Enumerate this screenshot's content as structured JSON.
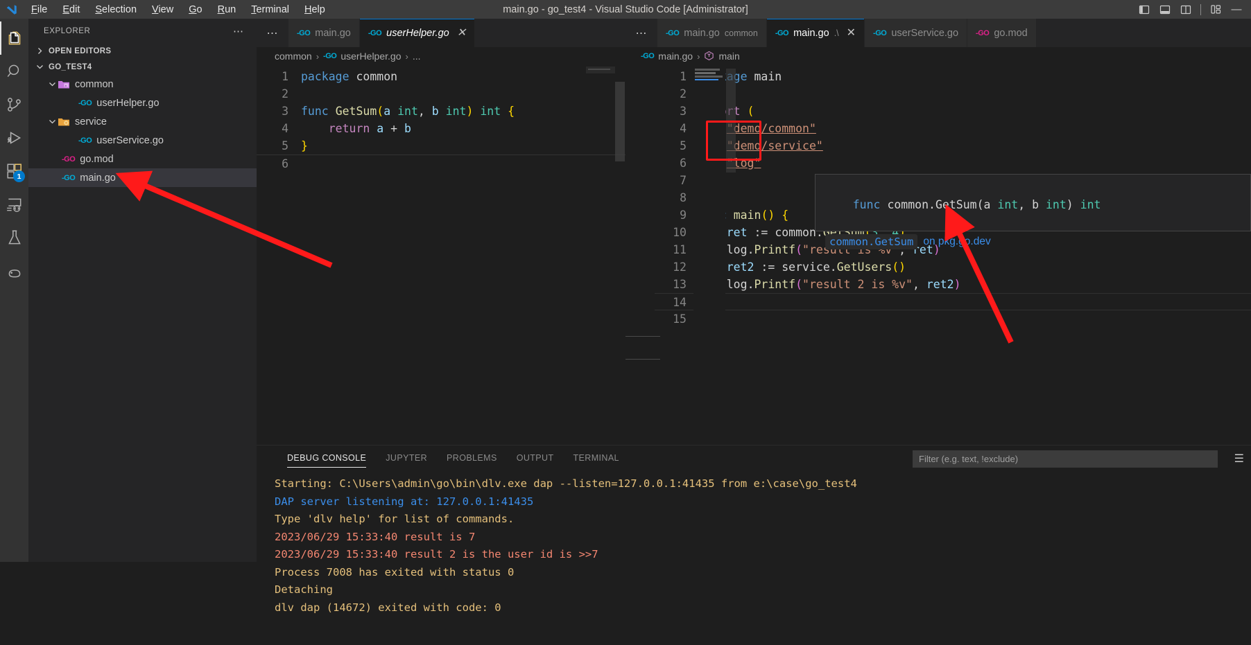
{
  "titlebar": {
    "window_title": "main.go - go_test4 - Visual Studio Code [Administrator]",
    "menus": [
      "File",
      "Edit",
      "Selection",
      "View",
      "Go",
      "Run",
      "Terminal",
      "Help"
    ],
    "layout_buttons": [
      {
        "name": "toggle-primary-sidebar-icon",
        "label": "Toggle Primary Side Bar"
      },
      {
        "name": "toggle-panel-icon",
        "label": "Toggle Panel"
      },
      {
        "name": "toggle-secondary-sidebar-icon",
        "label": "Toggle Secondary Side Bar"
      },
      {
        "name": "customize-layout-icon",
        "label": "Customize Layout"
      }
    ],
    "minimize_label": "—"
  },
  "activitybar": {
    "items": [
      {
        "name": "explorer",
        "icon": "files-icon",
        "active": true,
        "badge": null
      },
      {
        "name": "search",
        "icon": "search-icon",
        "active": false,
        "badge": null
      },
      {
        "name": "source-control",
        "icon": "source-control-icon",
        "active": false,
        "badge": null
      },
      {
        "name": "run-and-debug",
        "icon": "run-debug-icon",
        "active": false,
        "badge": null
      },
      {
        "name": "extensions",
        "icon": "extensions-icon",
        "active": false,
        "badge": "1"
      },
      {
        "name": "remote-explorer",
        "icon": "remote-explorer-icon",
        "active": false,
        "badge": null
      },
      {
        "name": "testing",
        "icon": "beaker-icon",
        "active": false,
        "badge": null
      },
      {
        "name": "python",
        "icon": "python-icon",
        "active": false,
        "badge": null
      }
    ]
  },
  "sidebar": {
    "title": "EXPLORER",
    "more_label": "⋯",
    "open_editors": {
      "label": "OPEN EDITORS",
      "expanded": false
    },
    "workspace": {
      "label": "GO_TEST4",
      "expanded": true
    },
    "tree": [
      {
        "label": "common",
        "type": "folder",
        "depth": 1,
        "expanded": true,
        "selected": false
      },
      {
        "label": "userHelper.go",
        "type": "go",
        "depth": 2,
        "selected": false
      },
      {
        "label": "service",
        "type": "folder",
        "depth": 1,
        "expanded": true,
        "selected": false
      },
      {
        "label": "userService.go",
        "type": "go",
        "depth": 2,
        "selected": false
      },
      {
        "label": "go.mod",
        "type": "gomod",
        "depth": 1,
        "selected": false
      },
      {
        "label": "main.go",
        "type": "go",
        "depth": 1,
        "selected": true
      }
    ]
  },
  "editor_left": {
    "more_label": "⋯",
    "tabs": [
      {
        "label": "main.go",
        "icon": "go-file-icon",
        "active": false,
        "preview": false,
        "closable": false,
        "description": ""
      },
      {
        "label": "userHelper.go",
        "icon": "go-file-icon",
        "active": true,
        "preview": true,
        "closable": true,
        "description": ""
      }
    ],
    "breadcrumb": [
      "common",
      "userHelper.go",
      "..."
    ],
    "lines": [
      {
        "n": "1",
        "tokens": [
          {
            "t": "package",
            "c": "kw"
          },
          {
            "t": " ",
            "c": "pun"
          },
          {
            "t": "common",
            "c": "ident"
          }
        ]
      },
      {
        "n": "2",
        "tokens": []
      },
      {
        "n": "3",
        "tokens": [
          {
            "t": "func",
            "c": "kw"
          },
          {
            "t": " ",
            "c": "pun"
          },
          {
            "t": "GetSum",
            "c": "fn"
          },
          {
            "t": "(",
            "c": "brk1"
          },
          {
            "t": "a ",
            "c": "var"
          },
          {
            "t": "int",
            "c": "typ"
          },
          {
            "t": ", ",
            "c": "pun"
          },
          {
            "t": "b ",
            "c": "var"
          },
          {
            "t": "int",
            "c": "typ"
          },
          {
            "t": ")",
            "c": "brk1"
          },
          {
            "t": " ",
            "c": "pun"
          },
          {
            "t": "int",
            "c": "typ"
          },
          {
            "t": " ",
            "c": "pun"
          },
          {
            "t": "{",
            "c": "brk1"
          }
        ]
      },
      {
        "n": "4",
        "tokens": [
          {
            "t": "    ",
            "c": "pun"
          },
          {
            "t": "return",
            "c": "kw2"
          },
          {
            "t": " a ",
            "c": "var"
          },
          {
            "t": "+",
            "c": "pun"
          },
          {
            "t": " b",
            "c": "var"
          }
        ]
      },
      {
        "n": "5",
        "tokens": [
          {
            "t": "}",
            "c": "brk1"
          }
        ]
      },
      {
        "n": "6",
        "tokens": []
      }
    ]
  },
  "editor_right": {
    "more_label": "⋯",
    "tabs": [
      {
        "label": "main.go",
        "icon": "go-file-icon",
        "active": false,
        "preview": false,
        "closable": false,
        "description": "common"
      },
      {
        "label": "main.go",
        "icon": "go-file-icon",
        "active": true,
        "preview": false,
        "closable": true,
        "description": ".\\"
      },
      {
        "label": "userService.go",
        "icon": "go-file-icon",
        "active": false,
        "preview": false,
        "closable": false,
        "description": ""
      },
      {
        "label": "go.mod",
        "icon": "gomod-file-icon",
        "active": false,
        "preview": false,
        "closable": false,
        "description": ""
      }
    ],
    "breadcrumb": [
      "main.go",
      "main"
    ],
    "lines": [
      {
        "n": "1",
        "tokens": [
          {
            "t": "package",
            "c": "kw"
          },
          {
            "t": " ",
            "c": "pun"
          },
          {
            "t": "main",
            "c": "ident"
          }
        ]
      },
      {
        "n": "2",
        "tokens": []
      },
      {
        "n": "3",
        "tokens": [
          {
            "t": "import",
            "c": "kw2"
          },
          {
            "t": " ",
            "c": "pun"
          },
          {
            "t": "(",
            "c": "brk1"
          }
        ]
      },
      {
        "n": "4",
        "tokens": [
          {
            "t": "    ",
            "c": "pun"
          },
          {
            "t": "\"demo/common\"",
            "c": "str uline"
          }
        ]
      },
      {
        "n": "5",
        "tokens": [
          {
            "t": "    ",
            "c": "pun"
          },
          {
            "t": "\"demo/service\"",
            "c": "str uline"
          }
        ]
      },
      {
        "n": "6",
        "tokens": [
          {
            "t": "    ",
            "c": "pun"
          },
          {
            "t": "\"log\"",
            "c": "str uline"
          }
        ]
      },
      {
        "n": "7",
        "tokens": [
          {
            "t": ")",
            "c": "brk1"
          }
        ]
      },
      {
        "n": "8",
        "tokens": []
      },
      {
        "n": "9",
        "tokens": [
          {
            "t": "func",
            "c": "kw"
          },
          {
            "t": " ",
            "c": "pun"
          },
          {
            "t": "main",
            "c": "fn"
          },
          {
            "t": "()",
            "c": "brk1"
          },
          {
            "t": " ",
            "c": "pun"
          },
          {
            "t": "{",
            "c": "brk1"
          }
        ]
      },
      {
        "n": "10",
        "tokens": [
          {
            "t": "    ",
            "c": "pun"
          },
          {
            "t": "ret",
            "c": "var"
          },
          {
            "t": " := ",
            "c": "pun"
          },
          {
            "t": "common",
            "c": "ident"
          },
          {
            "t": ".",
            "c": "pun"
          },
          {
            "t": "GetSum",
            "c": "fn"
          },
          {
            "t": "(",
            "c": "brk1"
          },
          {
            "t": "3",
            "c": "typ"
          },
          {
            "t": ", ",
            "c": "pun"
          },
          {
            "t": "4",
            "c": "typ"
          },
          {
            "t": ")",
            "c": "brk1"
          }
        ]
      },
      {
        "n": "11",
        "tokens": [
          {
            "t": "    ",
            "c": "pun"
          },
          {
            "t": "log",
            "c": "ident"
          },
          {
            "t": ".",
            "c": "pun"
          },
          {
            "t": "Printf",
            "c": "fn"
          },
          {
            "t": "(",
            "c": "brk2"
          },
          {
            "t": "\"result is %v\"",
            "c": "str"
          },
          {
            "t": ", ",
            "c": "pun"
          },
          {
            "t": "ret",
            "c": "var"
          },
          {
            "t": ")",
            "c": "brk2"
          }
        ]
      },
      {
        "n": "12",
        "tokens": [
          {
            "t": "    ",
            "c": "pun"
          },
          {
            "t": "ret2",
            "c": "var"
          },
          {
            "t": " := ",
            "c": "pun"
          },
          {
            "t": "service",
            "c": "ident"
          },
          {
            "t": ".",
            "c": "pun"
          },
          {
            "t": "GetUsers",
            "c": "fn"
          },
          {
            "t": "()",
            "c": "brk1"
          }
        ]
      },
      {
        "n": "13",
        "tokens": [
          {
            "t": "    ",
            "c": "pun"
          },
          {
            "t": "log",
            "c": "ident"
          },
          {
            "t": ".",
            "c": "pun"
          },
          {
            "t": "Printf",
            "c": "fn"
          },
          {
            "t": "(",
            "c": "brk2"
          },
          {
            "t": "\"result 2 is %v\"",
            "c": "str"
          },
          {
            "t": ", ",
            "c": "pun"
          },
          {
            "t": "ret2",
            "c": "var"
          },
          {
            "t": ")",
            "c": "brk2"
          }
        ]
      },
      {
        "n": "14",
        "tokens": [
          {
            "t": "}",
            "c": "brk1"
          }
        ]
      },
      {
        "n": "15",
        "tokens": []
      }
    ],
    "cursor_line": "14"
  },
  "hover_tooltip": {
    "signature_prefix": "func",
    "signature_name": "common.GetSum",
    "signature_args_open": "(a ",
    "signature_int1": "int",
    "signature_comma": ", b ",
    "signature_int2": "int",
    "signature_close": ") ",
    "signature_ret": "int",
    "link_code": "common.GetSum",
    "link_suffix": "on pkg.go.dev"
  },
  "panel": {
    "tabs": [
      "DEBUG CONSOLE",
      "JUPYTER",
      "PROBLEMS",
      "OUTPUT",
      "TERMINAL"
    ],
    "active_tab": "DEBUG CONSOLE",
    "filter_placeholder": "Filter (e.g. text, !exclude)",
    "filter_value": "",
    "more_label": "☰",
    "console_lines": [
      {
        "text": "Starting: C:\\Users\\admin\\go\\bin\\dlv.exe dap --listen=127.0.0.1:41435 from e:\\case\\go_test4",
        "color": "c-yellow"
      },
      {
        "text": "DAP server listening at: 127.0.0.1:41435",
        "color": "c-blue"
      },
      {
        "text": "Type 'dlv help' for list of commands.",
        "color": "c-yellow"
      },
      {
        "text": "2023/06/29 15:33:40 result is 7",
        "color": "c-red"
      },
      {
        "text": "2023/06/29 15:33:40 result 2 is the user id is >>7",
        "color": "c-red"
      },
      {
        "text": "Process 7008 has exited with status 0",
        "color": "c-yellow"
      },
      {
        "text": "Detaching",
        "color": "c-yellow"
      },
      {
        "text": "dlv dap (14672) exited with code: 0",
        "color": "c-yellow"
      }
    ]
  },
  "annotations": {
    "highlight_color": "#ff1a1a",
    "rect_label": "import-paths-highlight",
    "arrow1_label": "arrow-pointing-to-go-mod",
    "arrow2_label": "arrow-pointing-to-getsum-hover"
  }
}
